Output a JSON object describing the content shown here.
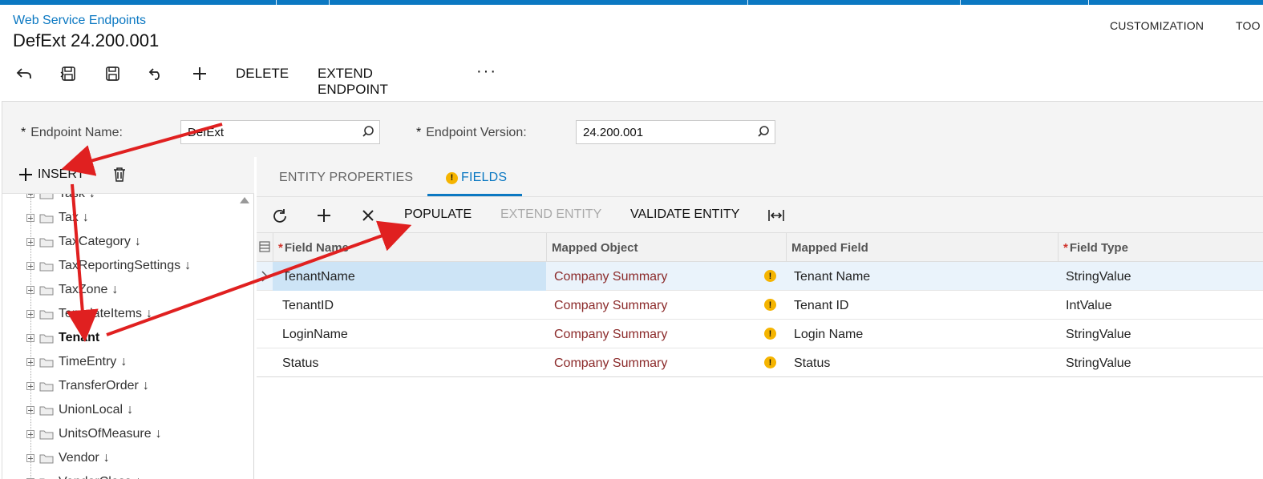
{
  "header": {
    "breadcrumb": "Web Service Endpoints",
    "title": "DefExt 24.200.001",
    "top_menu": [
      "CUSTOMIZATION",
      "TOO"
    ]
  },
  "toolbar": {
    "delete_label": "DELETE",
    "extend_endpoint_label": "EXTEND ENDPOINT",
    "more_label": "···"
  },
  "form": {
    "endpoint_name_label": "Endpoint Name:",
    "endpoint_name_value": "DefExt",
    "endpoint_version_label": "Endpoint Version:",
    "endpoint_version_value": "24.200.001",
    "required_mark": "*"
  },
  "left_panel": {
    "insert_label": "INSERT",
    "tree_items": [
      {
        "label": "Task",
        "arrow": "↓"
      },
      {
        "label": "Tax",
        "arrow": "↓"
      },
      {
        "label": "TaxCategory",
        "arrow": "↓"
      },
      {
        "label": "TaxReportingSettings",
        "arrow": "↓"
      },
      {
        "label": "TaxZone",
        "arrow": "↓"
      },
      {
        "label": "TemplateItems",
        "arrow": "↓"
      },
      {
        "label": "Tenant",
        "arrow": ""
      },
      {
        "label": "TimeEntry",
        "arrow": "↓"
      },
      {
        "label": "TransferOrder",
        "arrow": "↓"
      },
      {
        "label": "UnionLocal",
        "arrow": "↓"
      },
      {
        "label": "UnitsOfMeasure",
        "arrow": "↓"
      },
      {
        "label": "Vendor",
        "arrow": "↓"
      },
      {
        "label": "VendorClass",
        "arrow": "↓"
      }
    ]
  },
  "tabs": {
    "entity_properties": "ENTITY PROPERTIES",
    "fields": "FIELDS",
    "warn_glyph": "!"
  },
  "grid_toolbar": {
    "populate": "POPULATE",
    "extend_entity": "EXTEND ENTITY",
    "validate_entity": "VALIDATE ENTITY"
  },
  "grid": {
    "columns": {
      "field_name": "Field Name",
      "mapped_object": "Mapped Object",
      "mapped_field": "Mapped Field",
      "field_type": "Field Type"
    },
    "rows": [
      {
        "field_name": "TenantName",
        "mapped_object": "Company Summary",
        "mapped_field": "Tenant Name",
        "field_type": "StringValue"
      },
      {
        "field_name": "TenantID",
        "mapped_object": "Company Summary",
        "mapped_field": "Tenant ID",
        "field_type": "IntValue"
      },
      {
        "field_name": "LoginName",
        "mapped_object": "Company Summary",
        "mapped_field": "Login Name",
        "field_type": "StringValue"
      },
      {
        "field_name": "Status",
        "mapped_object": "Company Summary",
        "mapped_field": "Status",
        "field_type": "StringValue"
      }
    ]
  },
  "colors": {
    "accent": "#0b78c2",
    "warning": "#f5b400",
    "link": "#8b2a2a",
    "annotation_arrow": "#e02020"
  }
}
